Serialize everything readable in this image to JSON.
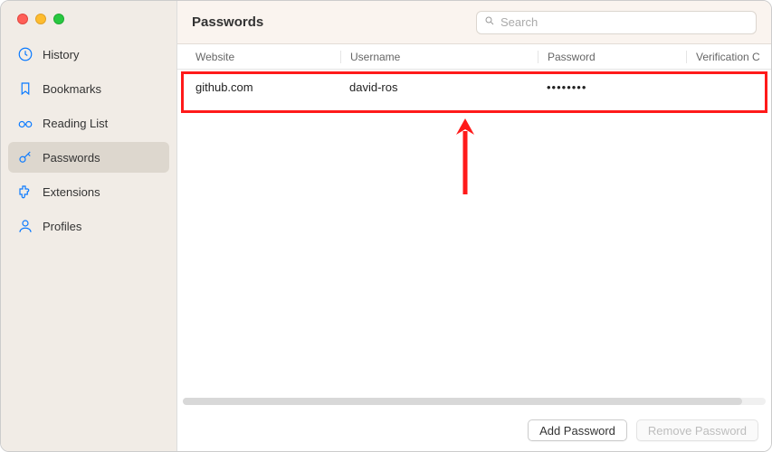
{
  "sidebar": {
    "items": [
      {
        "label": "History"
      },
      {
        "label": "Bookmarks"
      },
      {
        "label": "Reading List"
      },
      {
        "label": "Passwords"
      },
      {
        "label": "Extensions"
      },
      {
        "label": "Profiles"
      }
    ]
  },
  "header": {
    "title": "Passwords",
    "search_placeholder": "Search"
  },
  "table": {
    "columns": {
      "website": "Website",
      "username": "Username",
      "password": "Password",
      "verification": "Verification C"
    },
    "rows": [
      {
        "website": "github.com",
        "username": "david-ros",
        "password": "••••••••",
        "verification": ""
      }
    ]
  },
  "footer": {
    "add": "Add Password",
    "remove": "Remove Password"
  }
}
